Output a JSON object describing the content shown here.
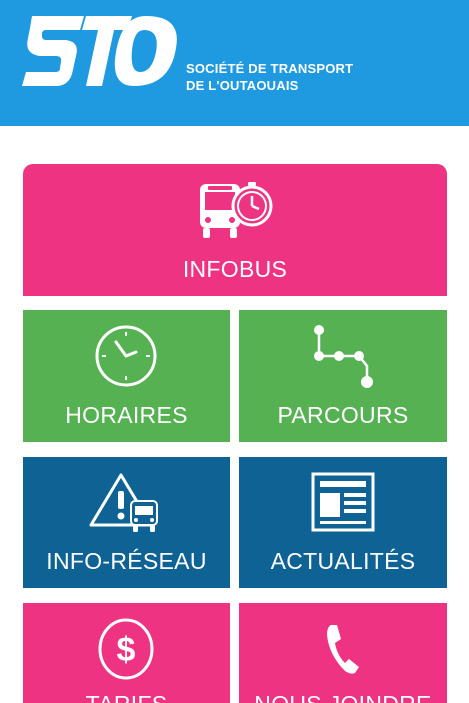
{
  "header": {
    "logo_name": "sto-logo",
    "logo_text": "STO",
    "org_line1": "SOCIÉTÉ DE TRANSPORT",
    "org_line2": "DE L'OUTAOUAIS"
  },
  "colors": {
    "header_blue": "#1f9ae1",
    "pink": "#ee3382",
    "green": "#55b152",
    "dark_blue": "#0f6394"
  },
  "menu": {
    "infobus": {
      "label": "INFOBUS",
      "icon": "bus-stopwatch-icon"
    },
    "horaires": {
      "label": "HORAIRES",
      "icon": "clock-icon"
    },
    "parcours": {
      "label": "PARCOURS",
      "icon": "route-icon"
    },
    "reseau": {
      "label": "INFO-RÉSEAU",
      "icon": "alert-bus-icon"
    },
    "actualites": {
      "label": "ACTUALITÉS",
      "icon": "newspaper-icon"
    },
    "tarifs": {
      "label": "TARIFS",
      "icon": "dollar-icon"
    },
    "joindre": {
      "label": "NOUS JOINDRE",
      "icon": "phone-icon"
    }
  }
}
